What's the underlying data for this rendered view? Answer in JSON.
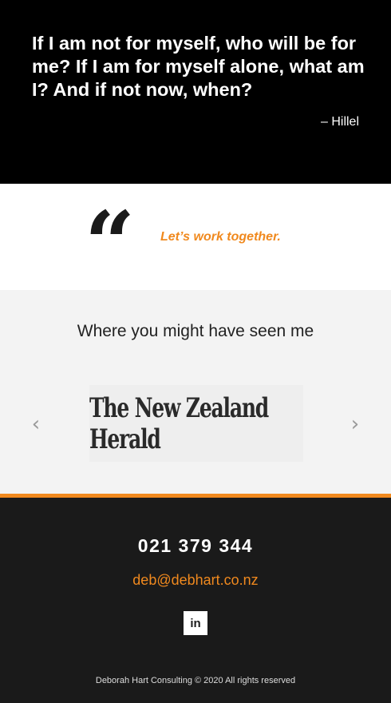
{
  "quote": {
    "text": "If I am not for myself, who will be for me? If I am for myself alone, what am I? And if not now, when?",
    "author": "– Hillel"
  },
  "cta": {
    "quote_mark": "“",
    "text": "Let’s work together."
  },
  "seen": {
    "title": "Where you might have seen me",
    "logo_text": "The New Zealand Herald",
    "prev_arrow": "‹",
    "next_arrow": "›"
  },
  "footer": {
    "phone": "021 379 344",
    "email": "deb@debhart.co.nz",
    "linkedin_label": "in",
    "copyright": "Deborah Hart Consulting © 2020 All rights reserved"
  },
  "colors": {
    "accent": "#f0891e",
    "dark": "#1a1a1a",
    "black": "#000000",
    "light_bg": "#f3f3f3"
  }
}
